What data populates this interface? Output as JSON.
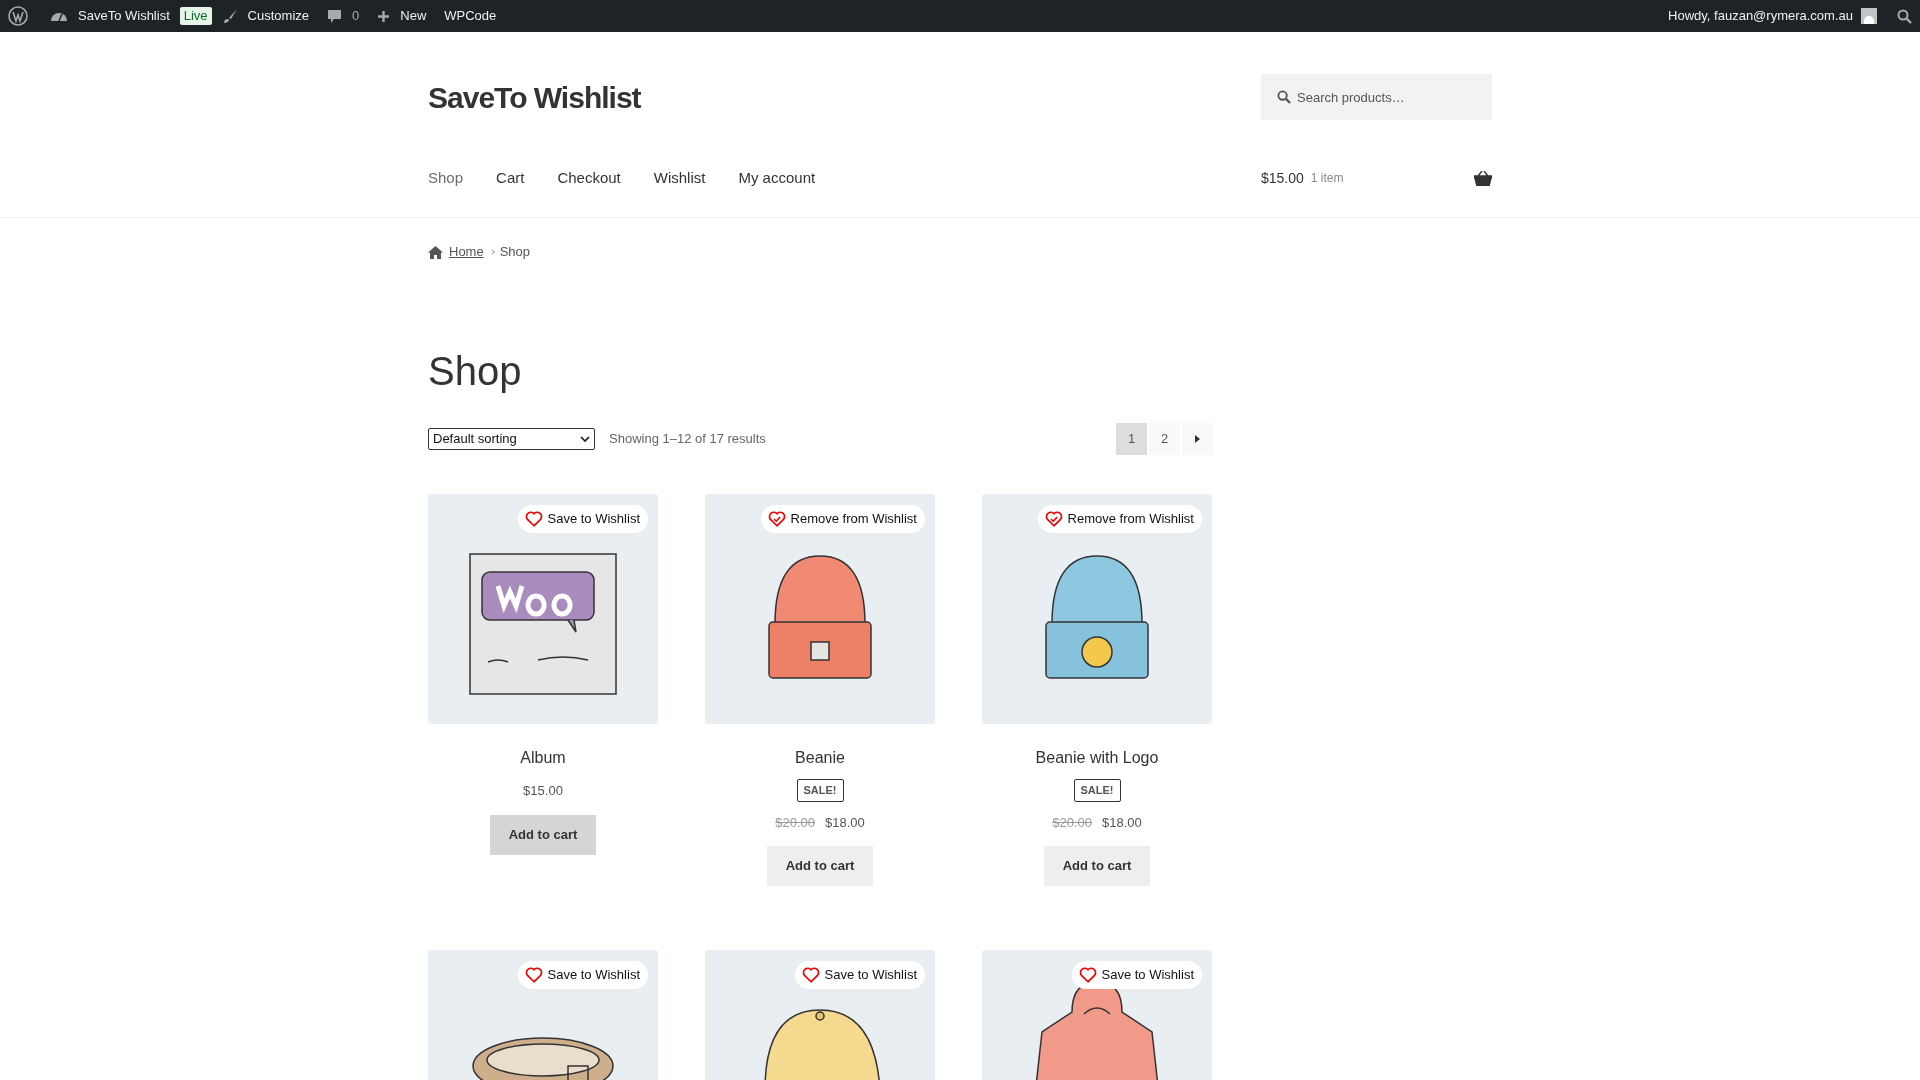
{
  "admin_bar": {
    "site": "SaveTo Wishlist",
    "badge": "Live",
    "customize": "Customize",
    "comments": "0",
    "new": "New",
    "plugin": "WPCode",
    "greeting": "Howdy, fauzan@rymera.com.au"
  },
  "site_title": "SaveTo Wishlist",
  "search": {
    "placeholder": "Search products…"
  },
  "nav": [
    {
      "label": "Shop",
      "selected": true
    },
    {
      "label": "Cart",
      "selected": false
    },
    {
      "label": "Checkout",
      "selected": false
    },
    {
      "label": "Wishlist",
      "selected": false
    },
    {
      "label": "My account",
      "selected": false
    }
  ],
  "cart": {
    "total": "$15.00",
    "count": "1 item"
  },
  "breadcrumb": [
    "Home",
    "Shop"
  ],
  "page_title": "Shop",
  "sorting": {
    "value": "Default sorting"
  },
  "result_count": "Showing 1–12 of 17 results",
  "pagination": [
    {
      "label": "1",
      "selected": true
    },
    {
      "label": "2",
      "selected": false
    }
  ],
  "products": [
    {
      "kind": "album",
      "wishlist": {
        "label": "Save to Wishlist",
        "saved": false
      },
      "name": "Album",
      "price": "$15.00",
      "button": {
        "label": "Add to cart",
        "hovered": true
      }
    },
    {
      "kind": "beanie",
      "wishlist": {
        "label": "Remove from Wishlist",
        "saved": true
      },
      "name": "Beanie",
      "sale_badge": "SALE!",
      "old_price": "$20.00",
      "price": "$18.00",
      "button": {
        "label": "Add to cart",
        "hovered": false
      }
    },
    {
      "kind": "beanie-logo",
      "wishlist": {
        "label": "Remove from Wishlist",
        "saved": true
      },
      "name": "Beanie with Logo",
      "sale_badge": "SALE!",
      "old_price": "$20.00",
      "price": "$18.00",
      "button": {
        "label": "Add to cart",
        "hovered": false
      }
    },
    {
      "kind": "belt",
      "wishlist": {
        "label": "Save to Wishlist",
        "saved": false
      }
    },
    {
      "kind": "cap",
      "wishlist": {
        "label": "Save to Wishlist",
        "saved": false
      }
    },
    {
      "kind": "hoodie",
      "wishlist": {
        "label": "Save to Wishlist",
        "saved": false
      }
    }
  ]
}
